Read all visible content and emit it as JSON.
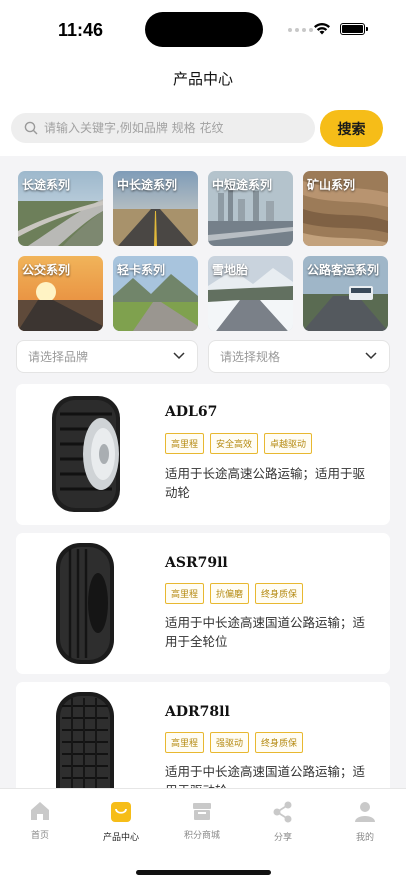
{
  "status_bar": {
    "time": "11:46"
  },
  "header": {
    "title": "产品中心"
  },
  "search": {
    "placeholder": "请输入关键字,例如品牌 规格 花纹",
    "button_label": "搜索"
  },
  "categories": [
    {
      "label": "长途系列",
      "icon": "highway-photo"
    },
    {
      "label": "中长途系列",
      "icon": "desert-road-photo"
    },
    {
      "label": "中短途系列",
      "icon": "city-skyline-photo"
    },
    {
      "label": "矿山系列",
      "icon": "mine-photo"
    },
    {
      "label": "公交系列",
      "icon": "sunset-road-photo"
    },
    {
      "label": "轻卡系列",
      "icon": "mountain-road-photo"
    },
    {
      "label": "雪地胎",
      "icon": "snow-road-photo"
    },
    {
      "label": "公路客运系列",
      "icon": "bus-road-photo"
    }
  ],
  "filters": {
    "brand_placeholder": "请选择品牌",
    "spec_placeholder": "请选择规格"
  },
  "products": [
    {
      "model": "ADL67",
      "tags": [
        "高里程",
        "安全高效",
        "卓越驱动"
      ],
      "description": "适用于长途高速公路运输；适用于驱动轮"
    },
    {
      "model": "ASR79ll",
      "tags": [
        "高里程",
        "抗偏磨",
        "终身质保"
      ],
      "description": "适用于中长途高速国道公路运输；适用于全轮位"
    },
    {
      "model": "ADR78ll",
      "tags": [
        "高里程",
        "强驱动",
        "终身质保"
      ],
      "description": "适用于中长途高速国道公路运输；适用于驱动轮"
    }
  ],
  "tabbar": [
    {
      "label": "首页",
      "icon": "home-icon"
    },
    {
      "label": "产品中心",
      "icon": "product-bag-icon",
      "active": true
    },
    {
      "label": "积分商城",
      "icon": "store-icon"
    },
    {
      "label": "分享",
      "icon": "share-icon"
    },
    {
      "label": "我的",
      "icon": "user-icon"
    }
  ],
  "colors": {
    "accent": "#f6bd18",
    "tag_border": "#e8b830",
    "tag_text": "#b58a12"
  }
}
